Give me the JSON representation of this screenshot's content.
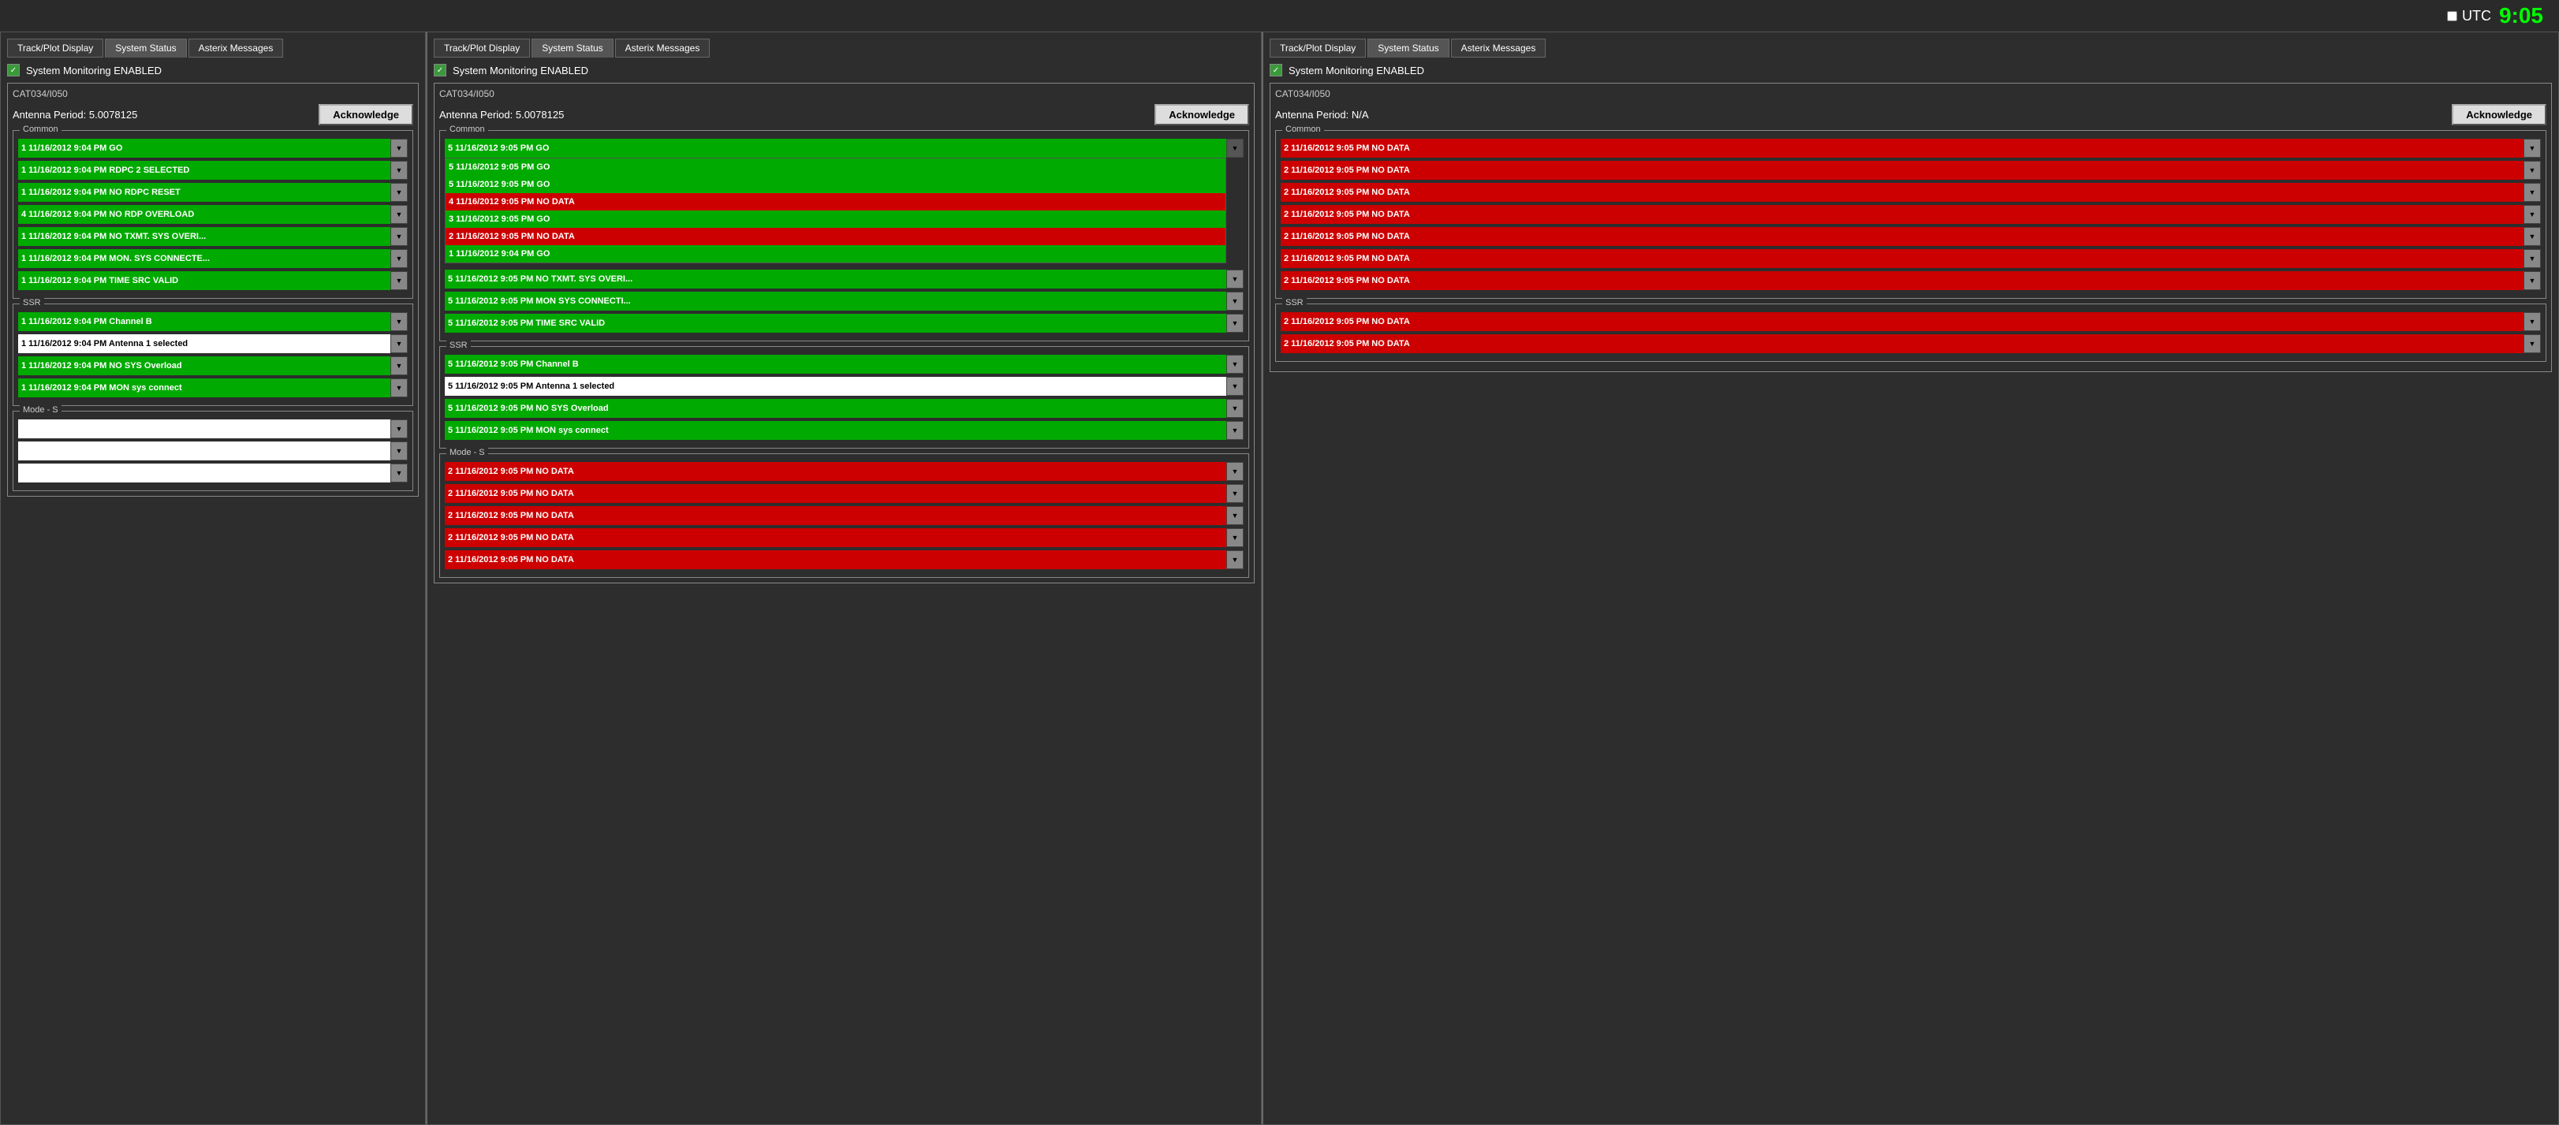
{
  "header": {
    "utc_label": "UTC",
    "time": "9:05",
    "time_color": "#00ff00"
  },
  "panels": [
    {
      "id": "left",
      "tabs": [
        "Track/Plot Display",
        "System Status",
        "Asterix Messages"
      ],
      "active_tab": "System Status",
      "system_monitoring": {
        "checked": true,
        "label": "System Monitoring ENABLED"
      },
      "cat034": {
        "label": "CAT034/I050",
        "antenna_period_label": "Antenna Period:",
        "antenna_period_value": "5.0078125",
        "acknowledge_label": "Acknowledge"
      },
      "common": {
        "title": "Common",
        "items": [
          {
            "text": "1 11/16/2012 9:04 PM GO",
            "status": "green"
          },
          {
            "text": "1 11/16/2012 9:04 PM RDPC 2 SELECTED",
            "status": "green"
          },
          {
            "text": "1 11/16/2012 9:04 PM NO RDPC RESET",
            "status": "green"
          },
          {
            "text": "4 11/16/2012 9:04 PM NO RDP OVERLOAD",
            "status": "green"
          },
          {
            "text": "1 11/16/2012 9:04 PM NO TXMT. SYS OVERI...",
            "status": "green"
          },
          {
            "text": "1 11/16/2012 9:04 PM MON. SYS CONNECTE...",
            "status": "green"
          },
          {
            "text": "1 11/16/2012 9:04 PM TIME SRC VALID",
            "status": "green"
          }
        ]
      },
      "ssr": {
        "title": "SSR",
        "items": [
          {
            "text": "1 11/16/2012 9:04 PM Channel B",
            "status": "green"
          },
          {
            "text": "1 11/16/2012 9:04 PM Antenna 1 selected",
            "status": "white"
          },
          {
            "text": "1 11/16/2012 9:04 PM NO SYS Overload",
            "status": "green"
          },
          {
            "text": "1 11/16/2012 9:04 PM MON sys connect",
            "status": "green"
          }
        ]
      },
      "mode_s": {
        "title": "Mode - S",
        "items": [
          {
            "text": "",
            "status": "white"
          },
          {
            "text": "",
            "status": "white"
          },
          {
            "text": "",
            "status": "white"
          }
        ]
      }
    },
    {
      "id": "middle",
      "tabs": [
        "Track/Plot Display",
        "System Status",
        "Asterix Messages"
      ],
      "active_tab": "System Status",
      "system_monitoring": {
        "checked": true,
        "label": "System Monitoring ENABLED"
      },
      "cat034": {
        "label": "CAT034/I050",
        "antenna_period_label": "Antenna Period:",
        "antenna_period_value": "5.0078125",
        "acknowledge_label": "Acknowledge"
      },
      "common": {
        "title": "Common",
        "open_dropdown": true,
        "open_selected": "5 11/16/2012 9:05 PM GO",
        "dropdown_items": [
          {
            "text": "5 11/16/2012 9:05 PM GO",
            "status": "green"
          },
          {
            "text": "5 11/16/2012 9:05 PM GO",
            "status": "green"
          },
          {
            "text": "4 11/16/2012 9:05 PM NO DATA",
            "status": "red"
          },
          {
            "text": "3 11/16/2012 9:05 PM GO",
            "status": "green"
          },
          {
            "text": "2 11/16/2012 9:05 PM NO DATA",
            "status": "red"
          },
          {
            "text": "1 11/16/2012 9:04 PM GO",
            "status": "green"
          }
        ],
        "items": [
          {
            "text": "5 11/16/2012 9:05 PM GO",
            "status": "green"
          },
          {
            "text": "5 11/16/2012 9:05 PM NO TXMT. SYS OVERI...",
            "status": "green"
          },
          {
            "text": "5 11/16/2012 9:05 PM MON SYS CONNECTI...",
            "status": "green"
          },
          {
            "text": "5 11/16/2012 9:05 PM TIME SRC VALID",
            "status": "green"
          }
        ]
      },
      "ssr": {
        "title": "SSR",
        "items": [
          {
            "text": "5 11/16/2012 9:05 PM Channel B",
            "status": "green"
          },
          {
            "text": "5 11/16/2012 9:05 PM Antenna 1 selected",
            "status": "white"
          },
          {
            "text": "5 11/16/2012 9:05 PM NO SYS Overload",
            "status": "green"
          },
          {
            "text": "5 11/16/2012 9:05 PM MON sys connect",
            "status": "green"
          }
        ]
      },
      "mode_s": {
        "title": "Mode - S",
        "items": [
          {
            "text": "2 11/16/2012 9:05 PM NO DATA",
            "status": "red"
          },
          {
            "text": "2 11/16/2012 9:05 PM NO DATA",
            "status": "red"
          },
          {
            "text": "2 11/16/2012 9:05 PM NO DATA",
            "status": "red"
          },
          {
            "text": "2 11/16/2012 9:05 PM NO DATA",
            "status": "red"
          },
          {
            "text": "2 11/16/2012 9:05 PM NO DATA",
            "status": "red"
          }
        ]
      }
    },
    {
      "id": "right",
      "tabs": [
        "Track/Plot Display",
        "System Status",
        "Asterix Messages"
      ],
      "active_tab": "System Status",
      "system_monitoring": {
        "checked": true,
        "label": "System Monitoring ENABLED"
      },
      "cat034": {
        "label": "CAT034/I050",
        "antenna_period_label": "Antenna Period:",
        "antenna_period_value": "N/A",
        "acknowledge_label": "Acknowledge"
      },
      "common": {
        "title": "Common",
        "items": [
          {
            "text": "2 11/16/2012 9:05 PM NO DATA",
            "status": "red"
          },
          {
            "text": "2 11/16/2012 9:05 PM NO DATA",
            "status": "red"
          },
          {
            "text": "2 11/16/2012 9:05 PM NO DATA",
            "status": "red"
          },
          {
            "text": "2 11/16/2012 9:05 PM NO DATA",
            "status": "red"
          },
          {
            "text": "2 11/16/2012 9:05 PM NO DATA",
            "status": "red"
          },
          {
            "text": "2 11/16/2012 9:05 PM NO DATA",
            "status": "red"
          },
          {
            "text": "2 11/16/2012 9:05 PM NO DATA",
            "status": "red"
          }
        ]
      },
      "ssr": {
        "title": "SSR",
        "items": [
          {
            "text": "2 11/16/2012 9:05 PM NO DATA",
            "status": "red"
          },
          {
            "text": "2 11/16/2012 9:05 PM NO DATA",
            "status": "red"
          }
        ]
      }
    }
  ]
}
